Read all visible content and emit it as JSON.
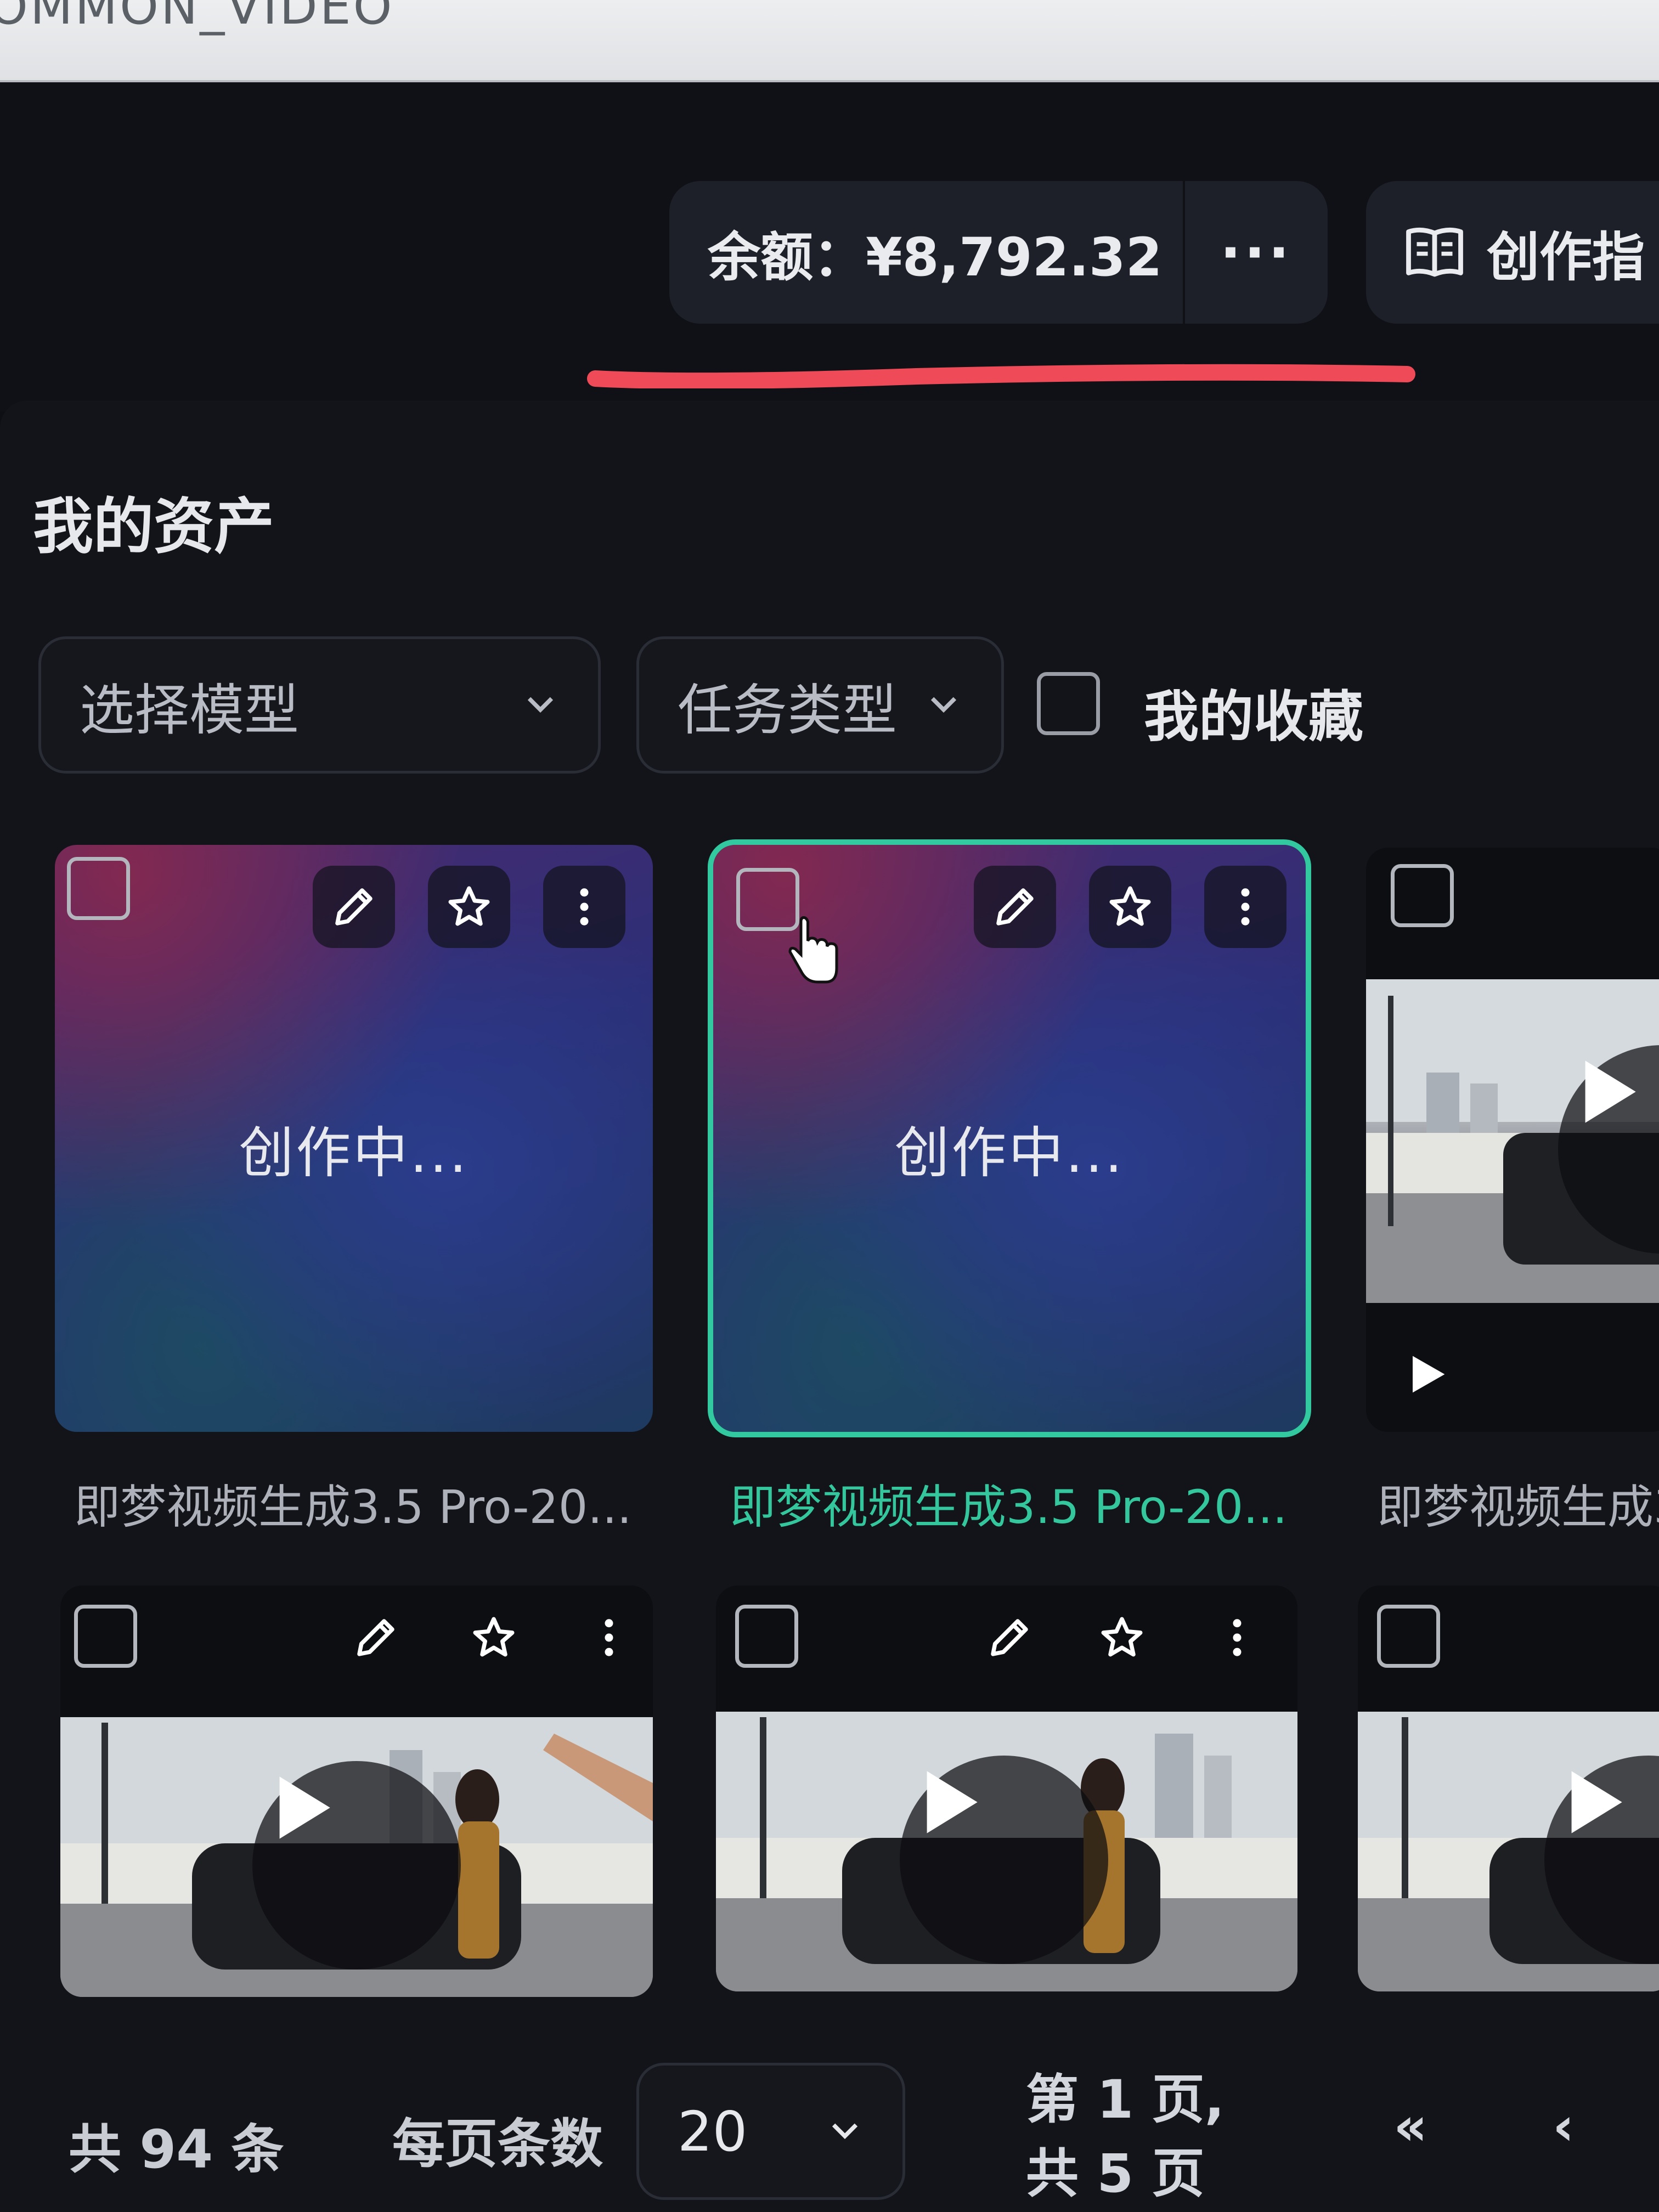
{
  "window": {
    "title": "OMMON_VIDEO"
  },
  "header": {
    "balance": "余额：¥8,792.32",
    "more_label": "···",
    "guide_label": "创作指",
    "guide_icon": "book-icon"
  },
  "assets": {
    "title": "我的资产",
    "filters": {
      "model_placeholder": "选择模型",
      "task_type_placeholder": "任务类型",
      "favorites_label": "我的收藏"
    },
    "cards": [
      {
        "status": "创作中...",
        "name": "即梦视频生成3.5 Pro-20..."
      },
      {
        "status": "创作中...",
        "name": "即梦视频生成3.5 Pro-20...",
        "selected": true
      },
      {
        "status": "",
        "name": "即梦视频生成3"
      },
      {
        "status": "",
        "name": ""
      },
      {
        "status": "",
        "name": ""
      },
      {
        "status": "",
        "name": ""
      }
    ]
  },
  "pagination": {
    "total": "共 94 条",
    "per_page_label": "每页条数",
    "per_page_value": "20",
    "page_line1": "第 1 页,",
    "page_line2": "共 5 页",
    "first_label": "«",
    "prev_label": "‹"
  },
  "colors": {
    "accent": "#34c79e",
    "underline": "#ef4a57",
    "background": "#12141a"
  }
}
